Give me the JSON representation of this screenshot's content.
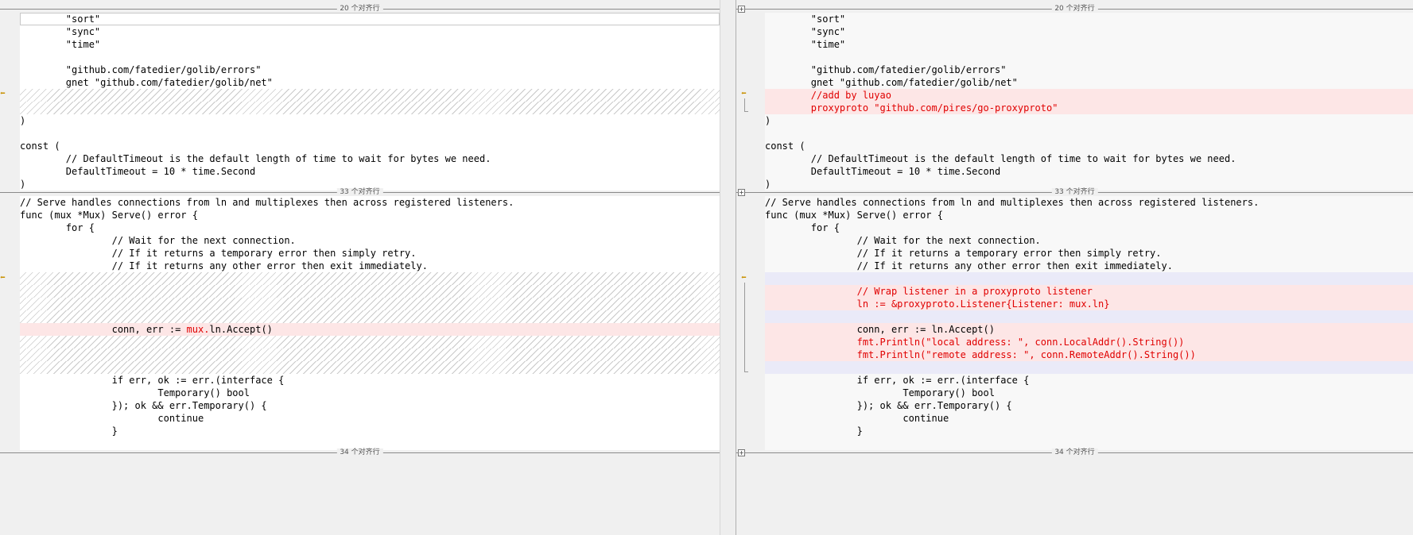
{
  "separators": {
    "top": "20 个对齐行",
    "mid": "33 个对齐行",
    "bottom": "34 个对齐行"
  },
  "left": {
    "block1": [
      {
        "text": "        \"sort\"",
        "type": "cur"
      },
      {
        "text": "        \"sync\"",
        "type": "normal"
      },
      {
        "text": "        \"time\"",
        "type": "normal"
      },
      {
        "text": "",
        "type": "normal"
      },
      {
        "text": "        \"github.com/fatedier/golib/errors\"",
        "type": "normal"
      },
      {
        "text": "        gnet \"github.com/fatedier/golib/net\"",
        "type": "normal"
      },
      {
        "text": "",
        "type": "hatch"
      },
      {
        "text": "",
        "type": "hatch"
      },
      {
        "text": ")",
        "type": "normal"
      },
      {
        "text": "",
        "type": "normal"
      },
      {
        "text": "const (",
        "type": "normal"
      },
      {
        "text": "        // DefaultTimeout is the default length of time to wait for bytes we need.",
        "type": "normal"
      },
      {
        "text": "        DefaultTimeout = 10 * time.Second",
        "type": "normal"
      },
      {
        "text": ")",
        "type": "normal"
      }
    ],
    "block2": [
      {
        "text": "// Serve handles connections from ln and multiplexes then across registered listeners.",
        "type": "normal"
      },
      {
        "text": "func (mux *Mux) Serve() error {",
        "type": "normal"
      },
      {
        "text": "        for {",
        "type": "normal"
      },
      {
        "text": "                // Wait for the next connection.",
        "type": "normal"
      },
      {
        "text": "                // If it returns a temporary error then simply retry.",
        "type": "normal"
      },
      {
        "text": "                // If it returns any other error then exit immediately.",
        "type": "normal"
      },
      {
        "text": "",
        "type": "hatch"
      },
      {
        "text": "",
        "type": "hatch"
      },
      {
        "text": "",
        "type": "hatch"
      },
      {
        "text": "",
        "type": "hatch"
      },
      {
        "pre": "                conn, err := ",
        "red": "mux.",
        "post": "ln.Accept()",
        "type": "del"
      },
      {
        "text": "",
        "type": "hatch"
      },
      {
        "text": "",
        "type": "hatch"
      },
      {
        "text": "",
        "type": "hatch"
      },
      {
        "text": "                if err, ok := err.(interface {",
        "type": "normal"
      },
      {
        "text": "                        Temporary() bool",
        "type": "normal"
      },
      {
        "text": "                }); ok && err.Temporary() {",
        "type": "normal"
      },
      {
        "text": "                        continue",
        "type": "normal"
      },
      {
        "text": "                }",
        "type": "normal"
      }
    ]
  },
  "right": {
    "block1": [
      {
        "text": "        \"sort\"",
        "type": "normal"
      },
      {
        "text": "        \"sync\"",
        "type": "normal"
      },
      {
        "text": "        \"time\"",
        "type": "normal"
      },
      {
        "text": "",
        "type": "normal"
      },
      {
        "text": "        \"github.com/fatedier/golib/errors\"",
        "type": "normal"
      },
      {
        "text": "        gnet \"github.com/fatedier/golib/net\"",
        "type": "normal"
      },
      {
        "red": "        //add by luyao",
        "type": "add"
      },
      {
        "red": "        proxyproto \"github.com/pires/go-proxyproto\"",
        "type": "add"
      },
      {
        "text": ")",
        "type": "normal"
      },
      {
        "text": "",
        "type": "normal"
      },
      {
        "text": "const (",
        "type": "normal"
      },
      {
        "text": "        // DefaultTimeout is the default length of time to wait for bytes we need.",
        "type": "normal"
      },
      {
        "text": "        DefaultTimeout = 10 * time.Second",
        "type": "normal"
      },
      {
        "text": ")",
        "type": "normal"
      }
    ],
    "block2": [
      {
        "text": "// Serve handles connections from ln and multiplexes then across registered listeners.",
        "type": "normal"
      },
      {
        "text": "func (mux *Mux) Serve() error {",
        "type": "normal"
      },
      {
        "text": "        for {",
        "type": "normal"
      },
      {
        "text": "                // Wait for the next connection.",
        "type": "normal"
      },
      {
        "text": "                // If it returns a temporary error then simply retry.",
        "type": "normal"
      },
      {
        "text": "                // If it returns any other error then exit immediately.",
        "type": "normal"
      },
      {
        "text": "",
        "type": "mod"
      },
      {
        "red": "                // Wrap listener in a proxyproto listener",
        "type": "add"
      },
      {
        "red": "                ln := &proxyproto.Listener{Listener: mux.ln}",
        "type": "add"
      },
      {
        "text": "",
        "type": "mod"
      },
      {
        "text": "                conn, err := ln.Accept()",
        "type": "add"
      },
      {
        "red": "                fmt.Println(\"local address: \", conn.LocalAddr().String())",
        "type": "add"
      },
      {
        "red": "                fmt.Println(\"remote address: \", conn.RemoteAddr().String())",
        "type": "add"
      },
      {
        "text": "",
        "type": "mod"
      },
      {
        "text": "                if err, ok := err.(interface {",
        "type": "normal"
      },
      {
        "text": "                        Temporary() bool",
        "type": "normal"
      },
      {
        "text": "                }); ok && err.Temporary() {",
        "type": "normal"
      },
      {
        "text": "                        continue",
        "type": "normal"
      },
      {
        "text": "                }",
        "type": "normal"
      }
    ]
  },
  "icons": {
    "diff_marker": "arrow-left-marker-icon",
    "expand": "expand-plus-icon"
  }
}
